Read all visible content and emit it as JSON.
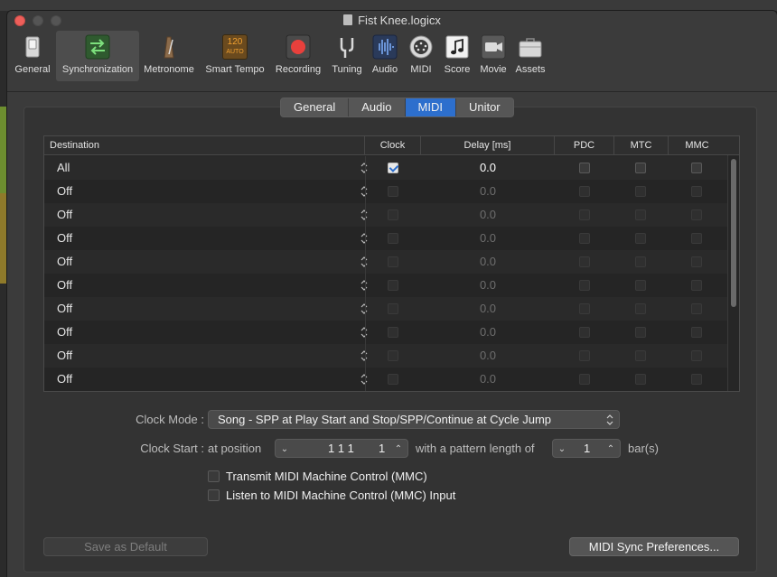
{
  "window": {
    "title": "Fist Knee.logicx"
  },
  "toolbar": {
    "items": [
      {
        "label": "General",
        "icon": "general-switch-icon"
      },
      {
        "label": "Synchronization",
        "icon": "sync-arrows-icon",
        "selected": true
      },
      {
        "label": "Metronome",
        "icon": "metronome-icon"
      },
      {
        "label": "Smart Tempo",
        "icon": "smart-tempo-icon",
        "badge_top": "120",
        "badge_bottom": "AUTO"
      },
      {
        "label": "Recording",
        "icon": "record-icon"
      },
      {
        "label": "Tuning",
        "icon": "tuning-fork-icon"
      },
      {
        "label": "Audio",
        "icon": "waveform-icon"
      },
      {
        "label": "MIDI",
        "icon": "midi-connector-icon"
      },
      {
        "label": "Score",
        "icon": "score-note-icon"
      },
      {
        "label": "Movie",
        "icon": "movie-camera-icon"
      },
      {
        "label": "Assets",
        "icon": "assets-case-icon"
      }
    ]
  },
  "tabs": [
    "General",
    "Audio",
    "MIDI",
    "Unitor"
  ],
  "active_tab": "MIDI",
  "table": {
    "headers": {
      "destination": "Destination",
      "clock": "Clock",
      "delay": "Delay [ms]",
      "pdc": "PDC",
      "mtc": "MTC",
      "mmc": "MMC"
    },
    "rows": [
      {
        "destination": "All",
        "clock": true,
        "delay": "0.0",
        "enabled": true
      },
      {
        "destination": "Off",
        "clock": false,
        "delay": "0.0",
        "enabled": false
      },
      {
        "destination": "Off",
        "clock": false,
        "delay": "0.0",
        "enabled": false
      },
      {
        "destination": "Off",
        "clock": false,
        "delay": "0.0",
        "enabled": false
      },
      {
        "destination": "Off",
        "clock": false,
        "delay": "0.0",
        "enabled": false
      },
      {
        "destination": "Off",
        "clock": false,
        "delay": "0.0",
        "enabled": false
      },
      {
        "destination": "Off",
        "clock": false,
        "delay": "0.0",
        "enabled": false
      },
      {
        "destination": "Off",
        "clock": false,
        "delay": "0.0",
        "enabled": false
      },
      {
        "destination": "Off",
        "clock": false,
        "delay": "0.0",
        "enabled": false
      },
      {
        "destination": "Off",
        "clock": false,
        "delay": "0.0",
        "enabled": false
      }
    ]
  },
  "clock_mode": {
    "label": "Clock Mode :",
    "value": "Song - SPP at Play Start and Stop/SPP/Continue at Cycle Jump"
  },
  "clock_start": {
    "label": "Clock Start :",
    "at_position": "at position",
    "position_value": "1 1 1",
    "position_tick": "1",
    "pattern_text": "with a pattern length of",
    "pattern_value": "1",
    "unit": "bar(s)"
  },
  "options": {
    "transmit_mmc": "Transmit MIDI Machine Control (MMC)",
    "listen_mmc": "Listen to MIDI Machine Control (MMC) Input"
  },
  "buttons": {
    "save_default": "Save as Default",
    "midi_sync_prefs": "MIDI Sync Preferences..."
  },
  "colors": {
    "accent": "#2d6fcd",
    "close": "#ee5f5a",
    "record": "#e8403c"
  }
}
